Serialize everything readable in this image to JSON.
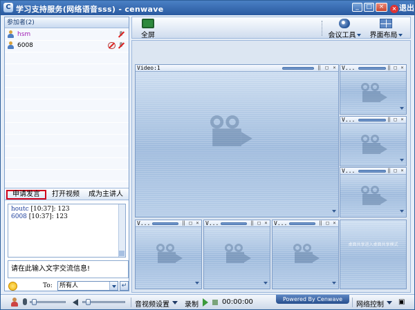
{
  "window": {
    "title": "学习支持服务(网络语音sss) - cenwave",
    "exit_label": "退出",
    "buttons": {
      "min": "_",
      "max": "□",
      "close": "×"
    }
  },
  "participants": {
    "header": "参加者(2)",
    "users": [
      {
        "name": "hsm",
        "color": "#a21cb5",
        "camera_off": false,
        "mic_off": true
      },
      {
        "name": "6008",
        "color": "#000000",
        "camera_off": true,
        "mic_off": true
      }
    ]
  },
  "actions": {
    "apply_speak": "申请发言",
    "open_video": "打开视频",
    "become_host": "成为主讲人"
  },
  "chat": {
    "messages": [
      {
        "name": "houtc",
        "time": "[10:37]:",
        "text": "123"
      },
      {
        "name": "6008",
        "time": "[10:37]:",
        "text": "123"
      }
    ],
    "input_placeholder": "请在此输入文字交流信息!",
    "to_label": "To:",
    "recipient": "所有人",
    "send_icon": "send-arrow-icon"
  },
  "toolbar": {
    "fullscreen": "全屏",
    "meeting_tools": "会议工具",
    "layout": "界面布局"
  },
  "videos": {
    "main_title": "Video:1",
    "small_title": "V...",
    "empty_hint": "桌面共享进入桌面共享模式"
  },
  "statusbar": {
    "av_settings": "音视频设置",
    "record": "录制",
    "time": "00:00:00",
    "powered_by": "Powered By Cenwave",
    "network_control": "网络控制"
  },
  "colors": {
    "titlebar": "#2a5aa0",
    "accent": "#d0021b",
    "chat_name": "#1b3d9b"
  }
}
